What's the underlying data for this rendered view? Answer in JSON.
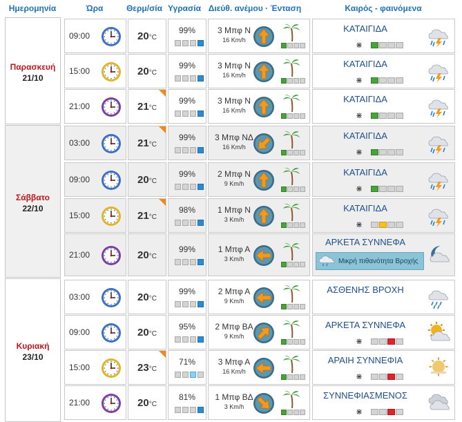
{
  "header": {
    "date": "Ημερομηνία",
    "time": "Ώρα",
    "temp": "Θερμ/σία",
    "humidity": "Υγρασία",
    "wind": "Διεύθ. ανέμου · Ένταση",
    "weather": "Καιρός - φαινόμενα"
  },
  "units": {
    "celsius": "°C"
  },
  "colors": {
    "header": "#1d72b8",
    "day_name": "#c0171c",
    "condition": "#1d4f8c",
    "flag": "#f08a1e"
  },
  "days": [
    {
      "name": "Παρασκευή",
      "date": "21/10"
    },
    {
      "name": "Σάββατο",
      "date": "22/10"
    },
    {
      "name": "Κυριακή",
      "date": "23/10"
    }
  ],
  "rows": [
    {
      "time": "09:00",
      "temp": "20",
      "humidity": "99%",
      "hum_level": 4,
      "wind_bf": "3 Μπφ Ν",
      "wind_kmh": "16 Km/h",
      "wind_dir": "N",
      "wind_level": 1,
      "condition": "ΚΑΤΑΙΓΙΔΑ",
      "mosquito": 1,
      "mosq_color": "g",
      "icon": "thunderstorm-icon",
      "flag": false
    },
    {
      "time": "15:00",
      "temp": "20",
      "humidity": "99%",
      "hum_level": 4,
      "wind_bf": "3 Μπφ Ν",
      "wind_kmh": "16 Km/h",
      "wind_dir": "N",
      "wind_level": 1,
      "condition": "ΚΑΤΑΙΓΙΔΑ",
      "mosquito": 1,
      "mosq_color": "g",
      "icon": "thunderstorm-icon",
      "flag": false
    },
    {
      "time": "21:00",
      "temp": "21",
      "humidity": "99%",
      "hum_level": 4,
      "wind_bf": "3 Μπφ Ν",
      "wind_kmh": "16 Km/h",
      "wind_dir": "N",
      "wind_level": 1,
      "condition": "ΚΑΤΑΙΓΙΔΑ",
      "mosquito": 1,
      "mosq_color": "g",
      "icon": "thunderstorm-icon",
      "flag": true
    },
    {
      "time": "03:00",
      "temp": "21",
      "humidity": "99%",
      "hum_level": 4,
      "wind_bf": "3 Μπφ ΝΔ",
      "wind_kmh": "16 Km/h",
      "wind_dir": "SW",
      "wind_level": 1,
      "condition": "ΚΑΤΑΙΓΙΔΑ",
      "mosquito": 1,
      "mosq_color": "g",
      "icon": "thunderstorm-icon",
      "flag": true
    },
    {
      "time": "09:00",
      "temp": "20",
      "humidity": "99%",
      "hum_level": 4,
      "wind_bf": "2 Μπφ Ν",
      "wind_kmh": "9 Km/h",
      "wind_dir": "N",
      "wind_level": 1,
      "condition": "ΚΑΤΑΙΓΙΔΑ",
      "mosquito": 1,
      "mosq_color": "g",
      "icon": "thunderstorm-icon",
      "flag": false
    },
    {
      "time": "15:00",
      "temp": "21",
      "humidity": "98%",
      "hum_level": 4,
      "wind_bf": "1 Μπφ Ν",
      "wind_kmh": "3 Km/h",
      "wind_dir": "N",
      "wind_level": 0,
      "condition": "ΚΑΤΑΙΓΙΔΑ",
      "mosquito": 2,
      "mosq_color": "y",
      "icon": "thunderstorm-icon",
      "flag": true
    },
    {
      "time": "21:00",
      "temp": "20",
      "humidity": "99%",
      "hum_level": 4,
      "wind_bf": "1 Μπφ Α",
      "wind_kmh": "3 Km/h",
      "wind_dir": "E",
      "wind_level": 0,
      "condition": "ΑΡΚΕΤΑ ΣΥΝΝΕΦΑ",
      "rain_note": "Μικρή πιθανότητα Βροχής",
      "icon": "night-cloud-icon",
      "flag": false
    },
    {
      "time": "03:00",
      "temp": "20",
      "humidity": "99%",
      "hum_level": 4,
      "wind_bf": "2 Μπφ Α",
      "wind_kmh": "9 Km/h",
      "wind_dir": "E",
      "wind_level": 1,
      "condition": "ΑΣΘΕΝΗΣ ΒΡΟΧΗ",
      "icon": "light-rain-icon",
      "flag": false
    },
    {
      "time": "09:00",
      "temp": "20",
      "humidity": "95%",
      "hum_level": 4,
      "wind_bf": "2 Μπφ ΒΑ",
      "wind_kmh": "9 Km/h",
      "wind_dir": "NE",
      "wind_level": 1,
      "condition": "ΑΡΚΕΤΑ ΣΥΝΝΕΦΑ",
      "mosquito": 3,
      "mosq_color": "r",
      "icon": "sun-cloud-icon",
      "flag": false
    },
    {
      "time": "15:00",
      "temp": "23",
      "humidity": "71%",
      "hum_level": 3,
      "wind_bf": "3 Μπφ Α",
      "wind_kmh": "16 Km/h",
      "wind_dir": "E",
      "wind_level": 1,
      "condition": "ΑΡΑΙΗ ΣΥΝΝΕΦΙΑ",
      "mosquito": 3,
      "mosq_color": "r",
      "icon": "sun-haze-icon",
      "flag": true
    },
    {
      "time": "21:00",
      "temp": "20",
      "humidity": "81%",
      "hum_level": 4,
      "wind_bf": "1 Μπφ ΒΔ",
      "wind_kmh": "3 Km/h",
      "wind_dir": "NW",
      "wind_level": 0,
      "condition": "ΣΥΝΝΕΦΙΑΣΜΕΝΟΣ",
      "mosquito": 3,
      "mosq_color": "r",
      "icon": "overcast-icon",
      "flag": false
    }
  ]
}
